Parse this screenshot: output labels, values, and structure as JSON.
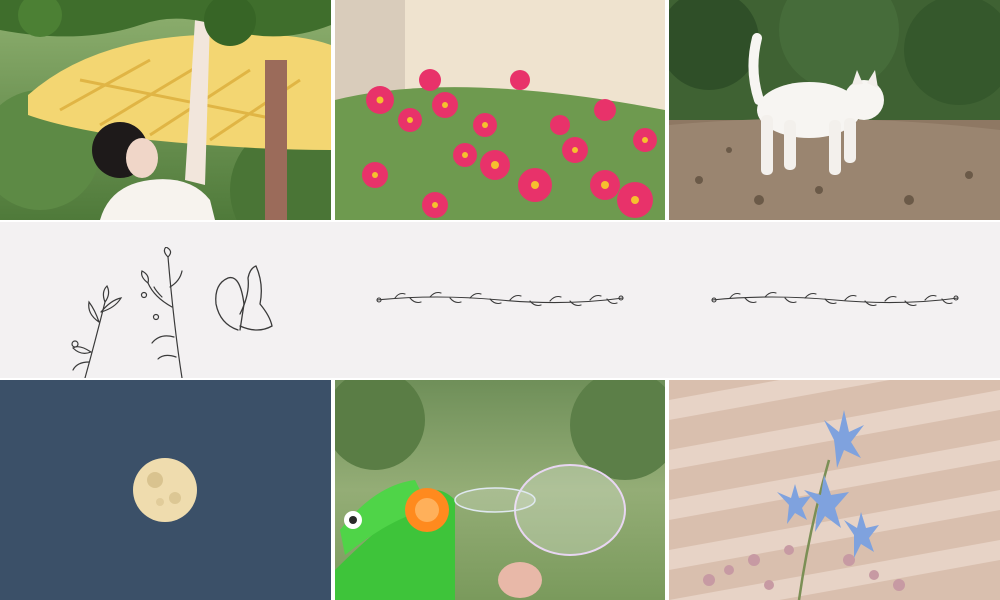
{
  "grid": {
    "top_row": [
      "girl-under-canopy",
      "pink-daisies",
      "white-cat"
    ],
    "bottom_row": [
      "full-moon",
      "bubble-toy",
      "blue-flowers"
    ]
  },
  "colors": {
    "divider": "#ffffff",
    "band_background": "#f3f1f2",
    "line_art": "#3a3a3a",
    "moon_sky": "#3b5068",
    "daisy_pink": "#e8326a",
    "delphinium_blue": "#7fa2de"
  }
}
